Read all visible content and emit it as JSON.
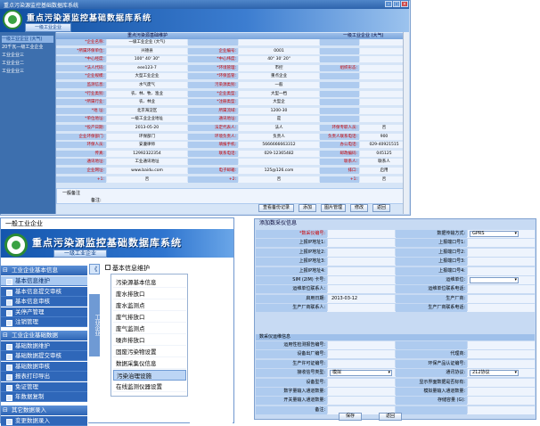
{
  "top_window": {
    "title": "重点污染源监控基础数据库系统",
    "tab": "一级工业企业",
    "sidebar": [
      {
        "label": "一级工业企业 (大气)",
        "selected": true
      },
      {
        "label": "20千瓦—级工业企业",
        "selected": false
      },
      {
        "label": "工业企业三",
        "selected": false
      },
      {
        "label": "工业企业二",
        "selected": false
      },
      {
        "label": "工业企业三",
        "selected": false
      }
    ],
    "form_header_left": "重点污染源基础维护",
    "form_header_right": "一级工业企业 (大气)",
    "rows": [
      {
        "l1": "*企业名称:",
        "v1": "一级工业企业 (大气)",
        "l2": "",
        "v2": "",
        "l3": "",
        "v3": ""
      },
      {
        "l1": "*所属环保单位:",
        "v1": "兴德县",
        "l2": "企业编号:",
        "v2": "0001",
        "l3": "",
        "v3": ""
      },
      {
        "l1": "*中心经度:",
        "v1": "100° 40' 30\"",
        "l2": "*中心纬度:",
        "v2": "40° 30' 20\"",
        "l3": "",
        "v3": ""
      },
      {
        "l1": "*法人代码:",
        "v1": "eee123-7",
        "l2": "*环境管理:",
        "v2": "市控",
        "l3": "组织形态:",
        "v3": ""
      },
      {
        "l1": "*企业规模:",
        "v1": "大型工业企业",
        "l2": "*环保监管:",
        "v2": "重点企业",
        "l3": "",
        "v3": ""
      },
      {
        "l1": "监测信息:",
        "v1": "水气废气",
        "l2": "污染源类别:",
        "v2": "一般",
        "l3": "",
        "v3": ""
      },
      {
        "l1": "*行业类别:",
        "v1": "农、林、牧、渔业",
        "l2": "*企业类型:",
        "v2": "大型一档",
        "l3": "",
        "v3": ""
      },
      {
        "l1": "*所属行业:",
        "v1": "农、林业",
        "l2": "*注册类型:",
        "v2": "大型企",
        "l3": "",
        "v3": ""
      },
      {
        "l1": "*地 址:",
        "v1": "北京海淀区",
        "l2": "所属流域:",
        "v2": "1200-30",
        "l3": "",
        "v3": ""
      },
      {
        "l1": "*单位地址:",
        "v1": "一级工业企业地址",
        "l2": "通讯地址:",
        "v2": "是",
        "l3": "",
        "v3": ""
      },
      {
        "l1": "*投产日期:",
        "v1": "2013-05-20",
        "l2": "法定代表人:",
        "v2": "法人",
        "l3": "环保专职人员:",
        "v3": "否"
      },
      {
        "l1": "企业环保部门:",
        "v1": "环保部门",
        "l2": "环境负责人:",
        "v2": "负责人",
        "l3": "负责人联系电话:",
        "v3": "900"
      },
      {
        "l1": "环保人员:",
        "v1": "安遵律师",
        "l2": "填报手机:",
        "v2": "5666666663312",
        "l3": "办公电话:",
        "v3": "029-40921515"
      },
      {
        "l1": "传真:",
        "v1": "12992322354",
        "l2": "联系电话:",
        "v2": "029-12365482",
        "l3": "邮政编码:",
        "v3": "045125"
      },
      {
        "l1": "通讯地址:",
        "v1": "工业通讯地址",
        "l2": "",
        "v2": "",
        "l3": "联系人:",
        "v3": "联系人"
      },
      {
        "l1": "企业网址:",
        "v1": "www.baidu.com",
        "l2": "电子邮箱:",
        "v2": "125@126.com",
        "l3": "排口:",
        "v3": "启用"
      },
      {
        "l1": "+1:",
        "v1": "否",
        "l2": "+2:",
        "v2": "否",
        "l3": "+1:",
        "v3": "否"
      }
    ],
    "note_label": "一般备注",
    "note_field_label": "备注:",
    "buttons": [
      "查看备份记录",
      "添加",
      "图片管理",
      "修改",
      "返回"
    ]
  },
  "left_window": {
    "top_label": "一般工业企业",
    "title": "重点污染源监控基础数据库系统",
    "tab": "一级工业企业",
    "collapse_glyph": "《",
    "vtab": "工业企业",
    "crumb": "基本信息维护",
    "groups": [
      {
        "label": "工业企业基本信息",
        "items": [
          {
            "label": "基本信息维护",
            "selected": true
          },
          {
            "label": "基本信息提交审核",
            "selected": false
          },
          {
            "label": "基本信息审核",
            "selected": false
          },
          {
            "label": "关停产管理",
            "selected": false
          },
          {
            "label": "注销管理",
            "selected": false
          }
        ]
      },
      {
        "label": "工业企业基础数据",
        "items": [
          {
            "label": "基础数据维护",
            "selected": false
          },
          {
            "label": "基础数据提交审核",
            "selected": false
          },
          {
            "label": "基础数据审核",
            "selected": false
          },
          {
            "label": "报表打印导出",
            "selected": false
          },
          {
            "label": "免证管理",
            "selected": false
          },
          {
            "label": "年数据复制",
            "selected": false
          }
        ]
      },
      {
        "label": "其它数据录入",
        "items": [
          {
            "label": "变更数据录入",
            "selected": false
          }
        ]
      }
    ],
    "dropdown": [
      {
        "label": "污染源基本信息",
        "selected": false
      },
      {
        "label": "废水排放口",
        "selected": false
      },
      {
        "label": "废水监测点",
        "selected": false
      },
      {
        "label": "废气排放口",
        "selected": false
      },
      {
        "label": "废气监测点",
        "selected": false
      },
      {
        "label": "噪声排放口",
        "selected": false
      },
      {
        "label": "固废污染物设置",
        "selected": false
      },
      {
        "label": "数据采集仪信息",
        "selected": false
      },
      {
        "label": "污染治理设施",
        "selected": true
      },
      {
        "label": "在线监测仪器设置",
        "selected": false
      }
    ]
  },
  "right_window": {
    "head": "添加数采仪信息",
    "rows": [
      {
        "l1": "*数采仪编号:",
        "v1": "",
        "l2": "数据传输方式:",
        "v2": "GPRS",
        "v2sel": true
      },
      {
        "l1": "上报IP地址1:",
        "v1": "",
        "l2": "上报端口号1:",
        "v2": ""
      },
      {
        "l1": "上报IP地址2:",
        "v1": "",
        "l2": "上报端口号2:",
        "v2": ""
      },
      {
        "l1": "上报IP地址3:",
        "v1": "",
        "l2": "上报端口号3:",
        "v2": ""
      },
      {
        "l1": "上报IP地址4:",
        "v1": "",
        "l2": "上报端口号4:",
        "v2": ""
      },
      {
        "l1": "SIM (2IM) 卡号:",
        "v1": "",
        "l2": "运维单位:",
        "v2": "",
        "v2sel": true
      },
      {
        "l1": "运维单位联系人:",
        "v1": "",
        "l2": "运维单位联系电话:",
        "v2": ""
      },
      {
        "l1": "启用日期:",
        "v1": "2013-03-12",
        "l2": "生产厂商:",
        "v2": ""
      },
      {
        "l1": "生产厂商联系人:",
        "v1": "",
        "l2": "生产厂商联系电话:",
        "v2": ""
      }
    ],
    "section": "数采仪运维信息",
    "rows2": [
      {
        "l1": "运用性检测报告编号:",
        "v1": "",
        "l2": "",
        "v2": ""
      },
      {
        "l1": "设备出厂编号:",
        "v1": "",
        "l2": "代理商:",
        "v2": ""
      },
      {
        "l1": "生产许可证编号:",
        "v1": "",
        "l2": "环保产品认证编号:",
        "v2": ""
      },
      {
        "l1": "接收信号类型:",
        "v1": "模拟",
        "v1sel": true,
        "l2": "通讯协议:",
        "v2": "212协议",
        "v2sel": true
      },
      {
        "l1": "设备型号:",
        "v1": "",
        "l2": "显示界面数据是否标有:",
        "v2": ""
      },
      {
        "l1": "数字量输入通道数量:",
        "v1": "",
        "l2": "模拟量输入通道数量:",
        "v2": ""
      },
      {
        "l1": "开关量输入通道数量:",
        "v1": "",
        "l2": "存储容量 (G):",
        "v2": ""
      },
      {
        "l1": "备注:",
        "v1": "",
        "l2": "",
        "v2": ""
      }
    ],
    "buttons": [
      "保存",
      "返回"
    ]
  }
}
